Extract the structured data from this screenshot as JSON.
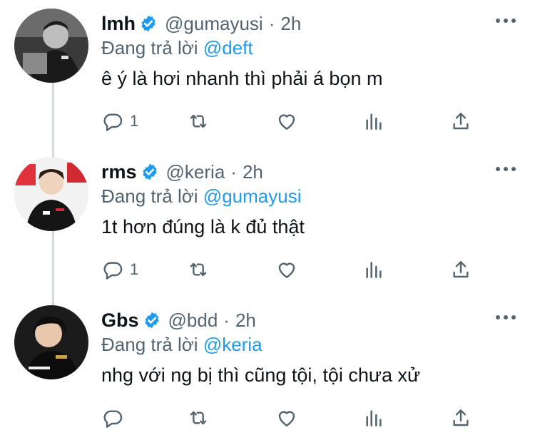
{
  "colors": {
    "accent": "#1d9bf0",
    "muted": "#536471",
    "text": "#0f1419",
    "thread": "#cfd9de"
  },
  "tweets": [
    {
      "name": "lmh",
      "handle": "@gumayusi",
      "separator": "·",
      "time": "2h",
      "reply_prefix": "Đang trả lời",
      "reply_to": "@deft",
      "text": "ê ý là hơi nhanh thì phải á bọn m",
      "reply_count": "1",
      "avatar": "grayscale-photo"
    },
    {
      "name": "rms",
      "handle": "@keria",
      "separator": "·",
      "time": "2h",
      "reply_prefix": "Đang trả lời",
      "reply_to": "@gumayusi",
      "text": "1t hơn đúng là k đủ thật",
      "reply_count": "1",
      "avatar": "color-photo"
    },
    {
      "name": "Gbs",
      "handle": "@bdd",
      "separator": "·",
      "time": "2h",
      "reply_prefix": "Đang trả lời",
      "reply_to": "@keria",
      "text": "nhg với ng bị thì cũng tội, tội chưa xử",
      "reply_count": "",
      "avatar": "dark-photo"
    }
  ],
  "icons": [
    "verified-icon",
    "more-icon",
    "reply-icon",
    "retweet-icon",
    "like-icon",
    "analytics-icon",
    "share-icon"
  ]
}
